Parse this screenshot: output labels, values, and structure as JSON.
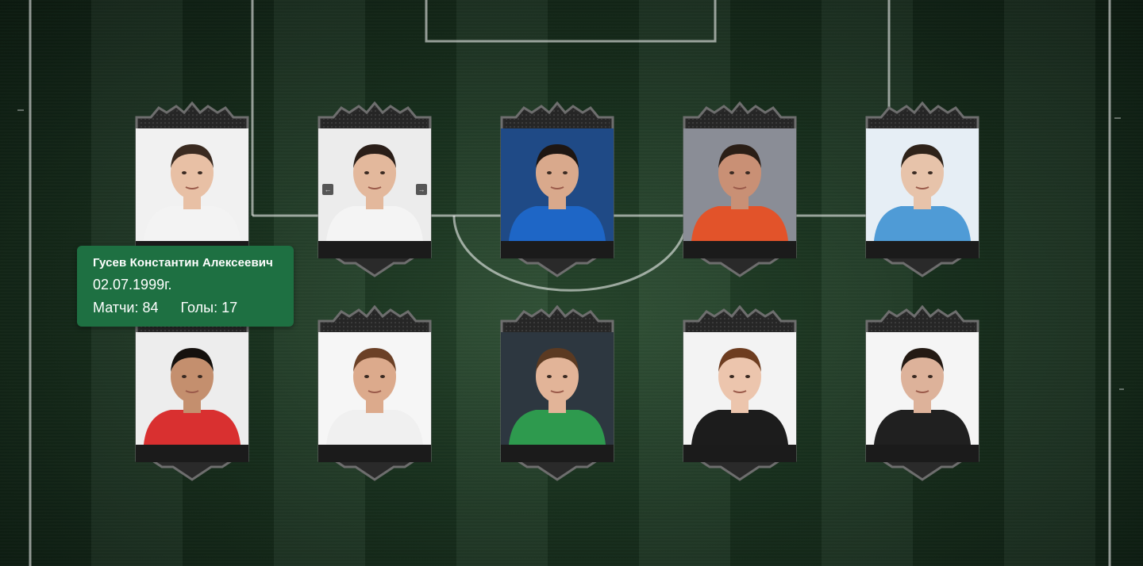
{
  "colors": {
    "pitch_dark": "#0d1c11",
    "pitch_mid": "#1a3420",
    "card_frame": "#2b2b2b",
    "card_border": "#6e6e6e",
    "tooltip_bg": "#1e7042",
    "tooltip_text": "#ffffff"
  },
  "tooltip": {
    "name": "Гусев Константин Алексеевич",
    "birth": "02.07.1999г.",
    "matches": "Матчи: 84",
    "goals": "Голы: 17"
  },
  "players": [
    {
      "id": "p1",
      "row": 1,
      "col": 1,
      "photo": {
        "bg": "#f1f1f1",
        "shirt": "#f3f3f3",
        "skin": "#e8c0a5",
        "hair": "#3a2a20"
      }
    },
    {
      "id": "p2",
      "row": 1,
      "col": 2,
      "photo": {
        "bg": "#ececec",
        "shirt": "#f4f4f4",
        "skin": "#e3b89c",
        "hair": "#2a1e18"
      },
      "carousel": {
        "prev_icon": "arrow-left-icon",
        "next_icon": "arrow-right-icon",
        "prev_glyph": "←",
        "next_glyph": "→"
      }
    },
    {
      "id": "p3",
      "row": 1,
      "col": 3,
      "photo": {
        "bg": "#1f4a86",
        "shirt": "#1e66c6",
        "skin": "#d9a98c",
        "hair": "#1e1612"
      }
    },
    {
      "id": "p4",
      "row": 1,
      "col": 4,
      "photo": {
        "bg": "#8a8d96",
        "shirt": "#e2532a",
        "skin": "#c99075",
        "hair": "#2a1e16"
      }
    },
    {
      "id": "p5",
      "row": 1,
      "col": 5,
      "photo": {
        "bg": "#e6eef5",
        "shirt": "#4f9bd6",
        "skin": "#e7c3aa",
        "hair": "#2e2219"
      }
    },
    {
      "id": "p6",
      "row": 2,
      "col": 1,
      "photo": {
        "bg": "#ededed",
        "shirt": "#d93030",
        "skin": "#c48f6e",
        "hair": "#15110e"
      }
    },
    {
      "id": "p7",
      "row": 2,
      "col": 2,
      "photo": {
        "bg": "#f6f6f6",
        "shirt": "#f0f0f0",
        "skin": "#dcaa8c",
        "hair": "#6b4026"
      }
    },
    {
      "id": "p8",
      "row": 2,
      "col": 3,
      "photo": {
        "bg": "#2d3740",
        "shirt": "#2e9a4e",
        "skin": "#e2b498",
        "hair": "#5b3a22"
      }
    },
    {
      "id": "p9",
      "row": 2,
      "col": 4,
      "photo": {
        "bg": "#f3f3f3",
        "shirt": "#1c1c1c",
        "skin": "#ecc5ad",
        "hair": "#6e3d20"
      }
    },
    {
      "id": "p10",
      "row": 2,
      "col": 5,
      "photo": {
        "bg": "#f5f5f5",
        "shirt": "#202020",
        "skin": "#ddb29a",
        "hair": "#241a14"
      }
    }
  ]
}
